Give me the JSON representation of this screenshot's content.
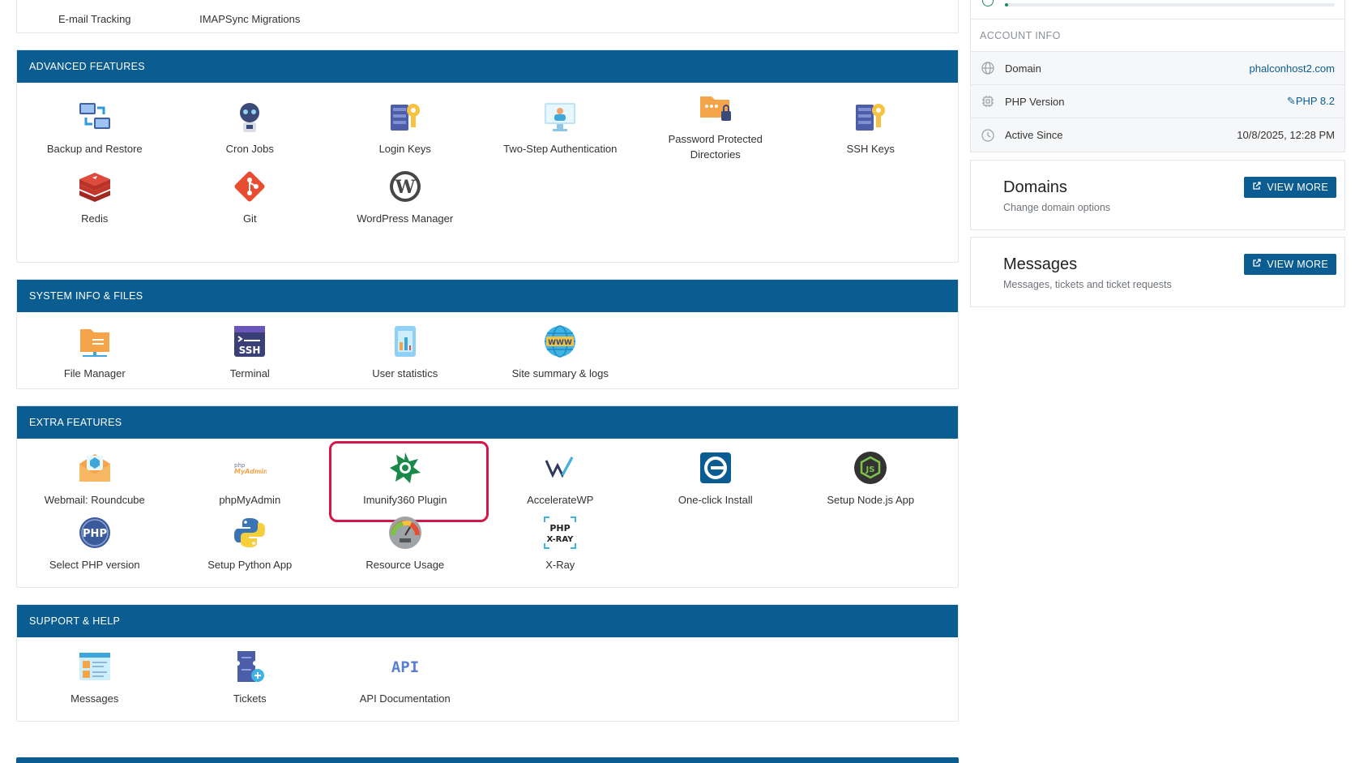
{
  "top_strip": {
    "items": [
      {
        "label": "E-mail Tracking"
      },
      {
        "label": "IMAPSync Migrations"
      }
    ]
  },
  "advanced": {
    "title": "ADVANCED FEATURES",
    "items": [
      {
        "label": "Backup and Restore",
        "icon": "backup-icon"
      },
      {
        "label": "Cron Jobs",
        "icon": "cron-robot-icon"
      },
      {
        "label": "Login Keys",
        "icon": "login-keys-icon"
      },
      {
        "label": "Two-Step Authentication",
        "icon": "two-step-auth-icon"
      },
      {
        "label": "Password Protected Directories",
        "icon": "password-folder-icon"
      },
      {
        "label": "SSH Keys",
        "icon": "ssh-keys-icon"
      },
      {
        "label": "Redis",
        "icon": "redis-icon"
      },
      {
        "label": "Git",
        "icon": "git-icon"
      },
      {
        "label": "WordPress Manager",
        "icon": "wordpress-icon"
      }
    ]
  },
  "system": {
    "title": "SYSTEM INFO & FILES",
    "items": [
      {
        "label": "File Manager",
        "icon": "file-manager-icon"
      },
      {
        "label": "Terminal",
        "icon": "terminal-ssh-icon"
      },
      {
        "label": "User statistics",
        "icon": "user-statistics-icon"
      },
      {
        "label": "Site summary & logs",
        "icon": "globe-www-icon"
      }
    ]
  },
  "extra": {
    "title": "EXTRA FEATURES",
    "items": [
      {
        "label": "Webmail: Roundcube",
        "icon": "roundcube-icon"
      },
      {
        "label": "phpMyAdmin",
        "icon": "phpmyadmin-icon"
      },
      {
        "label": "Imunify360 Plugin",
        "icon": "imunify360-icon"
      },
      {
        "label": "AccelerateWP",
        "icon": "acceleratewp-icon"
      },
      {
        "label": "One-click Install",
        "icon": "one-click-install-icon"
      },
      {
        "label": "Setup Node.js App",
        "icon": "nodejs-icon"
      },
      {
        "label": "Select PHP version",
        "icon": "php-icon"
      },
      {
        "label": "Setup Python App",
        "icon": "python-icon"
      },
      {
        "label": "Resource Usage",
        "icon": "resource-gauge-icon"
      },
      {
        "label": "X-Ray",
        "icon": "php-xray-icon"
      }
    ]
  },
  "support": {
    "title": "SUPPORT & HELP",
    "items": [
      {
        "label": "Messages",
        "icon": "messages-icon"
      },
      {
        "label": "Tickets",
        "icon": "tickets-icon"
      },
      {
        "label": "API Documentation",
        "icon": "api-icon"
      }
    ]
  },
  "account": {
    "title": "ACCOUNT INFO",
    "progress_fraction": 0.01,
    "rows": [
      {
        "label": "Domain",
        "value": "phalconhost2.com"
      },
      {
        "label": "PHP Version",
        "value": "PHP 8.2"
      },
      {
        "label": "Active Since",
        "value": "10/8/2025, 12:28 PM"
      }
    ]
  },
  "cards": [
    {
      "title": "Domains",
      "subtitle": "Change domain options",
      "button": "VIEW MORE"
    },
    {
      "title": "Messages",
      "subtitle": "Messages, tickets and ticket requests",
      "button": "VIEW MORE"
    }
  ],
  "colors": {
    "header": "#0b5c91",
    "highlight": "#d4174a",
    "accent": "#1f8a5b"
  }
}
